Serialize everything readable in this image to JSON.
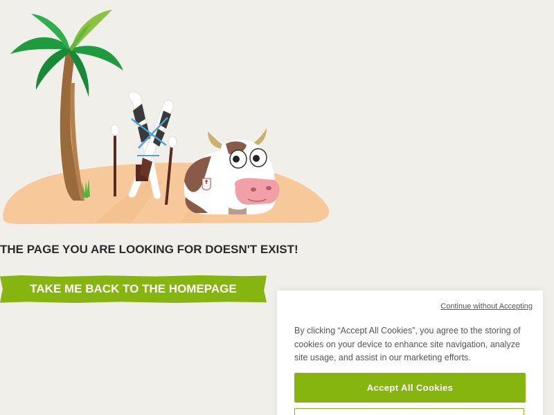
{
  "error": {
    "title": "THE PAGE YOU ARE LOOKING FOR DOESN'T EXIST!",
    "home_button_label": "TAKE ME BACK TO THE HOMEPAGE"
  },
  "illustration": {
    "icons": [
      "palm-tree-icon",
      "skis-icon",
      "ski-poles-icon",
      "cow-icon",
      "sand-island-icon"
    ]
  },
  "cookie_banner": {
    "continue_label": "Continue without Accepting",
    "message": "By clicking “Accept All Cookies”, you agree to the storing of cookies on your device to enhance site navigation, analyze site usage, and assist in our marketing efforts.",
    "accept_label": "Accept All Cookies"
  },
  "colors": {
    "background": "#f1efea",
    "accent_green": "#86b50f",
    "sand": "#f7c99a",
    "text_dark": "#2a2a2a",
    "text_muted": "#555555"
  }
}
